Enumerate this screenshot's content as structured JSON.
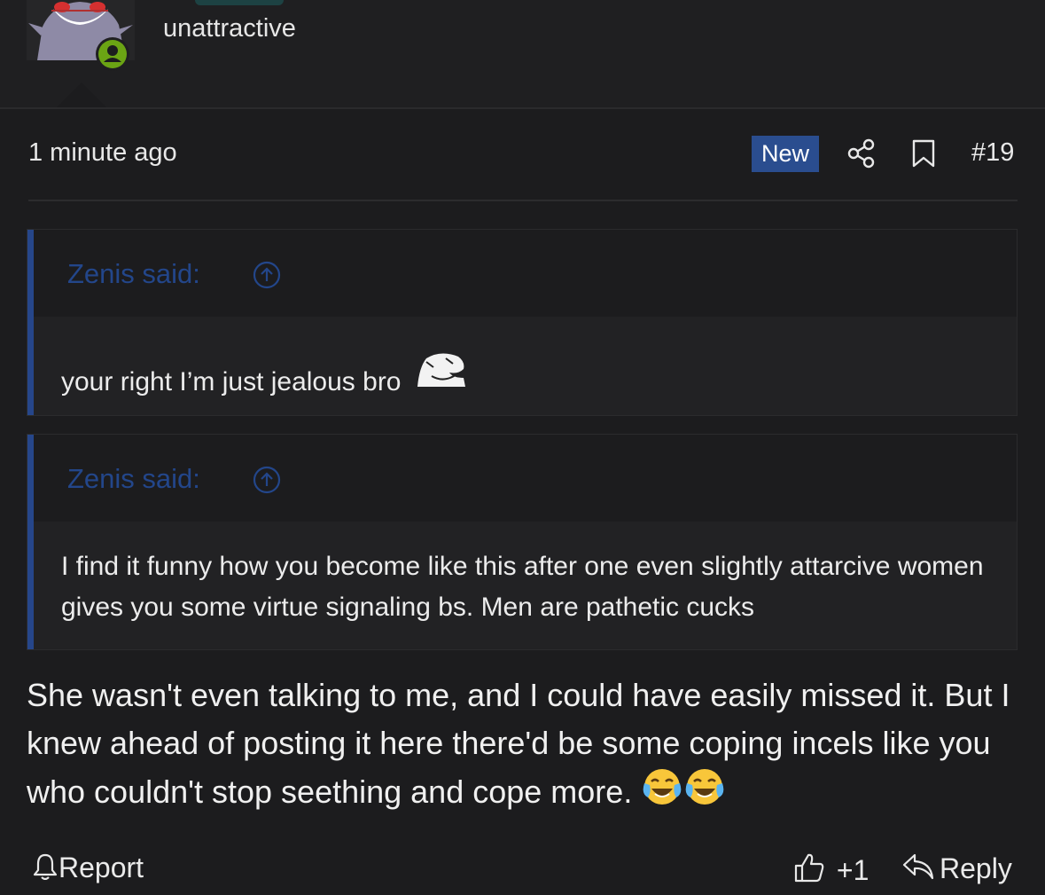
{
  "header": {
    "user_title": "unattractive",
    "avatar_name": "gengar-avatar",
    "online_status": "online"
  },
  "post": {
    "time": "1 minute ago",
    "badge": "New",
    "number": "#19",
    "icons": [
      "share-icon",
      "bookmark-icon"
    ],
    "quotes": [
      {
        "author_label": "Zenis said:",
        "text": "your right I’m just jealous bro",
        "has_smiley": true
      },
      {
        "author_label": "Zenis said:",
        "text": "I find it funny how you become like this after one even slightly attarcive women gives you some virtue signaling bs. Men are pathetic cucks",
        "has_smiley": false
      }
    ],
    "body": "She wasn't even talking to me, and I could have easily missed it. But I knew ahead of posting it here there'd be some coping incels like you who couldn't stop seething and cope more.",
    "emoji": [
      "face-with-tears-of-joy",
      "face-with-tears-of-joy"
    ]
  },
  "footer": {
    "report_label": "Report",
    "like_count": "+1",
    "reply_label": "Reply"
  },
  "colors": {
    "background": "#1c1c1e",
    "accent_blue": "#2a4d8f",
    "quote_bar": "#26468a",
    "online_green": "#6ba414"
  }
}
